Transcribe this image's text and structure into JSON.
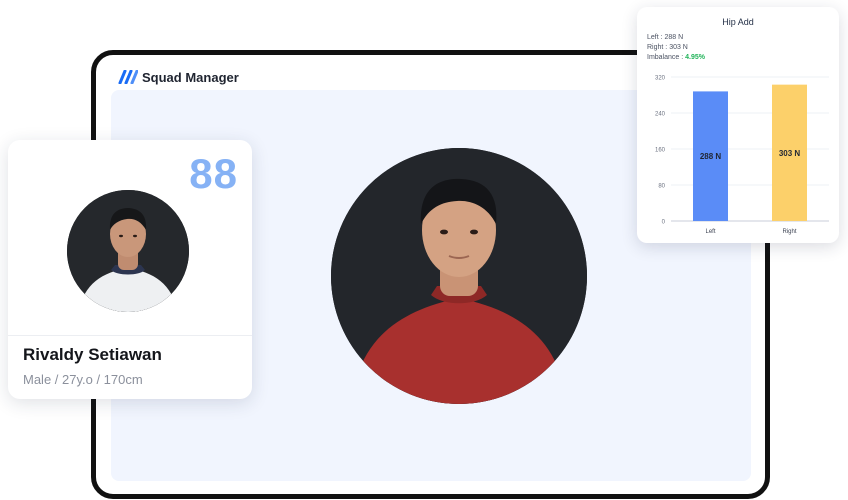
{
  "app": {
    "brand_name": "Squad Manager",
    "brand_color": "#1a6cf5",
    "screen_color": "#f1f5fe"
  },
  "athlete": {
    "score": "88",
    "score_color": "#86b2f5",
    "name": "Rivaldy Setiawan",
    "details": "Male / 27y.o / 170cm",
    "portrait_small": "athlete-photo",
    "portrait_large": "athlete-photo"
  },
  "test": {
    "title": "Hip Add",
    "left_label": "Left : ",
    "left_value": "288 N",
    "right_label": "Right : ",
    "right_value": "303 N",
    "imbalance_label": "Imbalance : ",
    "imbalance_value": "4.95%",
    "imbalance_color": "#22b45a"
  },
  "chart_data": {
    "type": "bar",
    "title": "Hip Add",
    "xlabel": "",
    "ylabel": "",
    "categories": [
      "Left",
      "Right"
    ],
    "values": [
      288,
      303
    ],
    "data_labels": [
      "288 N",
      "303 N"
    ],
    "colors": [
      "#5a8cf7",
      "#fcd06a"
    ],
    "ylim": [
      0,
      320
    ],
    "yticks": [
      "0",
      "80",
      "160",
      "240",
      "320"
    ],
    "grid": true,
    "legend": "none"
  }
}
